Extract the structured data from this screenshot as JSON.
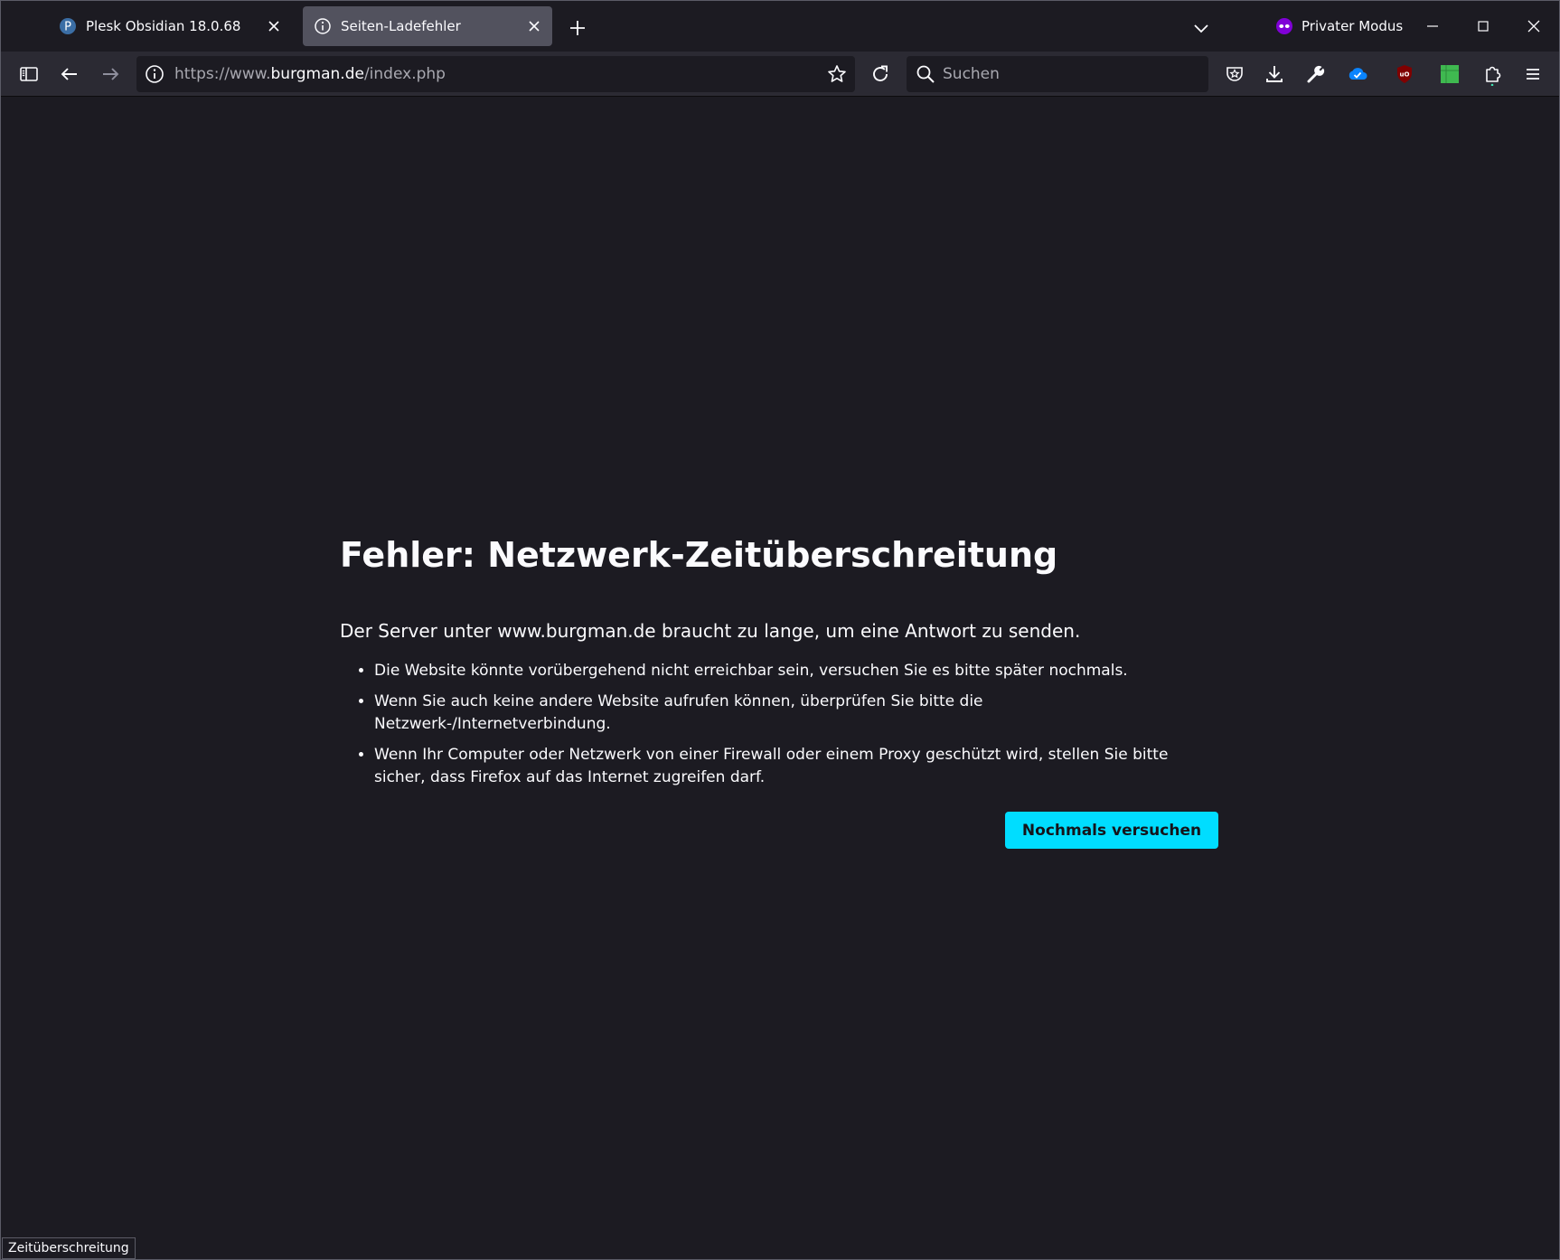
{
  "browser": {
    "tabs": [
      {
        "label": "Plesk Obsidian 18.0.68",
        "icon": "plesk-favicon-icon",
        "active": false
      },
      {
        "label": "Seiten-Ladefehler",
        "icon": "info-icon",
        "active": true
      }
    ],
    "private_mode_label": "Privater Modus",
    "url": {
      "scheme": "https://www.",
      "host": "burgman.de",
      "path": "/index.php"
    },
    "search": {
      "placeholder": "Suchen",
      "value": ""
    }
  },
  "error_page": {
    "title": "Fehler: Netzwerk-Zeitüberschreitung",
    "summary": "Der Server unter www.burgman.de braucht zu lange, um eine Antwort zu senden.",
    "bullets": [
      "Die Website könnte vorübergehend nicht erreichbar sein, versuchen Sie es bitte später nochmals.",
      "Wenn Sie auch keine andere Website aufrufen können, überprüfen Sie bitte die Netzwerk-/Internetverbindung.",
      "Wenn Ihr Computer oder Netzwerk von einer Firewall oder einem Proxy geschützt wird, stellen Sie bitte sicher, dass Firefox auf das Internet zugreifen darf."
    ],
    "retry_label": "Nochmals versuchen"
  },
  "status_text": "Zeitüberschreitung",
  "colors": {
    "background": "#1c1b22",
    "toolbar": "#2b2a33",
    "accent_button": "#00ddff",
    "private_mode_purple": "#8000d7",
    "ublock_red": "#800000",
    "extension_green": "#3fb950"
  }
}
